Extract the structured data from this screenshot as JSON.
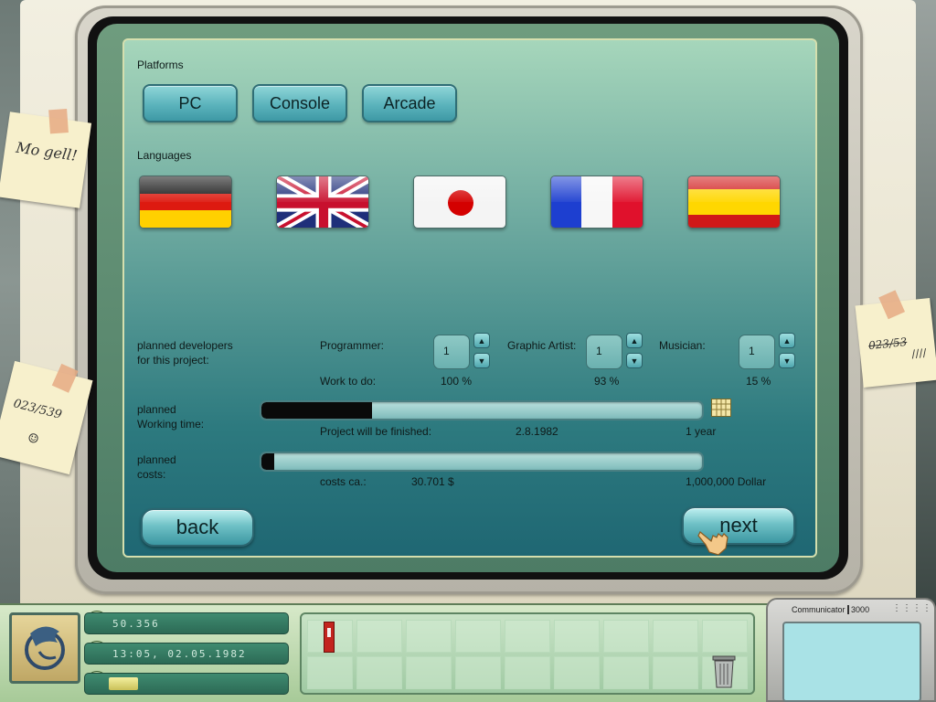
{
  "platforms": {
    "heading": "Platforms",
    "options": [
      "PC",
      "Console",
      "Arcade"
    ]
  },
  "languages": {
    "heading": "Languages",
    "flags": [
      "german-flag-icon",
      "uk-flag-icon",
      "japan-flag-icon",
      "france-flag-icon",
      "spain-flag-icon"
    ]
  },
  "developers": {
    "heading_line1": "planned developers",
    "heading_line2": "for this project:",
    "work_label": "Work to do:",
    "roles": [
      {
        "label": "Programmer:",
        "count": "1",
        "work": "100 %"
      },
      {
        "label": "Graphic Artist:",
        "count": "1",
        "work": "93 %"
      },
      {
        "label": "Musician:",
        "count": "1",
        "work": "15 %"
      }
    ]
  },
  "working_time": {
    "label_line1": "planned",
    "label_line2": "Working time:",
    "progress": 0.25,
    "finish_label": "Project will be finished:",
    "finish_date": "2.8.1982",
    "max_label": "1 year"
  },
  "costs": {
    "label_line1": "planned",
    "label_line2": "costs:",
    "progress": 0.03,
    "costs_label": "costs ca.:",
    "costs_value": "30.701 $",
    "max_label": "1,000,000 Dollar"
  },
  "nav": {
    "back": "back",
    "next": "next"
  },
  "status": {
    "money": "50.356",
    "datetime": "13:05, 02.05.1982",
    "money_icon": "dollar-icon",
    "clock_icon": "clock-icon",
    "progress_icon": "snail-icon",
    "progress": 0.2
  },
  "notes": {
    "left_top": "Mo gell!",
    "left_bottom": "023/539",
    "right": "023/53"
  },
  "communicator": {
    "title": "Communicator",
    "model": "3000"
  }
}
